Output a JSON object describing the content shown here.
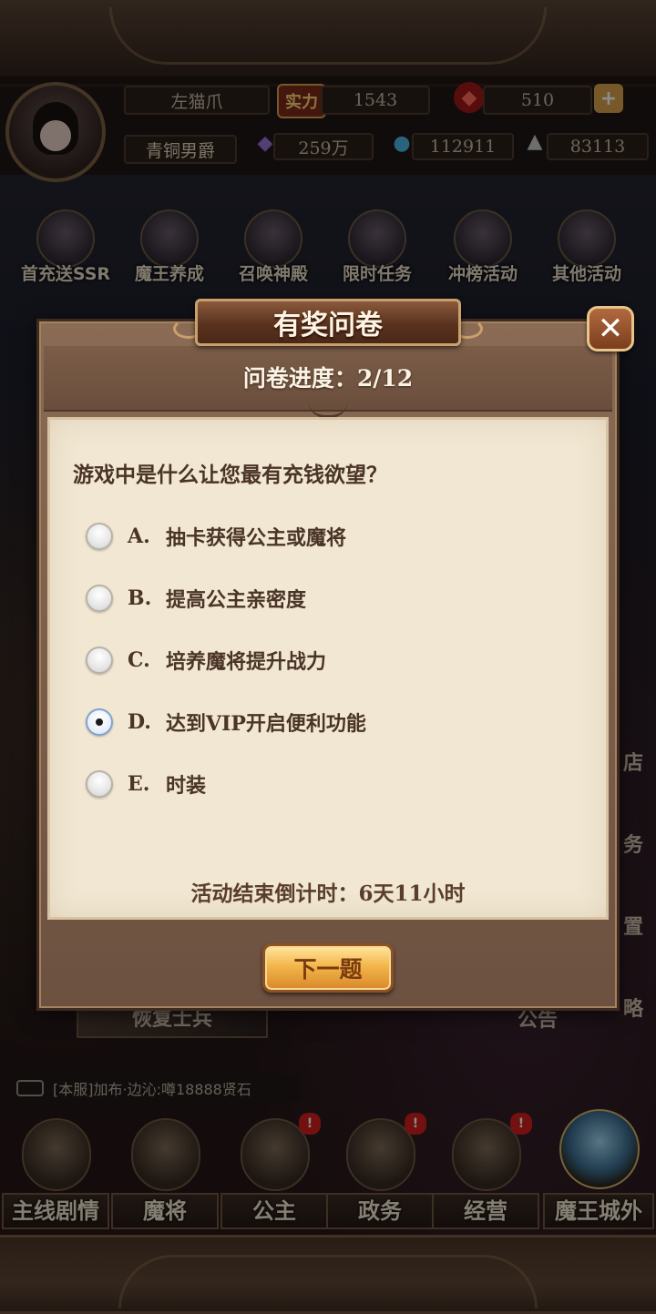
{
  "player": {
    "name": "左猫爪",
    "rank_title": "青铜男爵",
    "power_label": "实力",
    "power": "1543",
    "gems": "510",
    "currency_1": "259万",
    "currency_2": "112911",
    "currency_3": "83113"
  },
  "menu": {
    "items": [
      {
        "label": "首充送SSR",
        "icon": "ssr-icon"
      },
      {
        "label": "魔王养成",
        "icon": "demon-king-icon"
      },
      {
        "label": "召唤神殿",
        "icon": "summon-temple-icon"
      },
      {
        "label": "限时任务",
        "icon": "timed-quest-icon"
      },
      {
        "label": "冲榜活动",
        "icon": "ranking-event-icon"
      },
      {
        "label": "其他活动",
        "icon": "other-events-icon"
      }
    ]
  },
  "background_labels": {
    "restore_soldiers": "恢复士兵",
    "announcement": "公告",
    "side_1": "店",
    "side_2": "务",
    "side_3": "置",
    "side_4": "略"
  },
  "chat": {
    "message": "[本服]加布·边沁:噂18888贤石"
  },
  "bottom_nav": {
    "items": [
      {
        "label": "主线剧情",
        "icon": "story-book-icon",
        "badge": false
      },
      {
        "label": "魔将",
        "icon": "sword-shield-icon",
        "badge": false
      },
      {
        "label": "公主",
        "icon": "princess-icon",
        "badge": true
      },
      {
        "label": "政务",
        "icon": "scroll-icon",
        "badge": true
      },
      {
        "label": "经营",
        "icon": "hourglass-icon",
        "badge": true
      },
      {
        "label": "魔王城外",
        "icon": "crystal-icon",
        "badge": false
      }
    ],
    "badge_text": "!"
  },
  "dialog": {
    "title": "有奖问卷",
    "close_glyph": "✕",
    "progress": "问卷进度：2/12",
    "question": "游戏中是什么让您最有充钱欲望？",
    "options": [
      {
        "letter": "A.",
        "text": "抽卡获得公主或魔将",
        "selected": false
      },
      {
        "letter": "B.",
        "text": "提高公主亲密度",
        "selected": false
      },
      {
        "letter": "C.",
        "text": "培养魔将提升战力",
        "selected": false
      },
      {
        "letter": "D.",
        "text": "达到VIP开启便利功能",
        "selected": true
      },
      {
        "letter": "E.",
        "text": "时装",
        "selected": false
      }
    ],
    "countdown": "活动结束倒计时：6天11小时",
    "next_button": "下一题"
  },
  "colors": {
    "panel_bg": "#f1e7d2",
    "text_brown": "#4a3426",
    "button_gold": "#f3b64a",
    "close_orange": "#b26a3e"
  }
}
